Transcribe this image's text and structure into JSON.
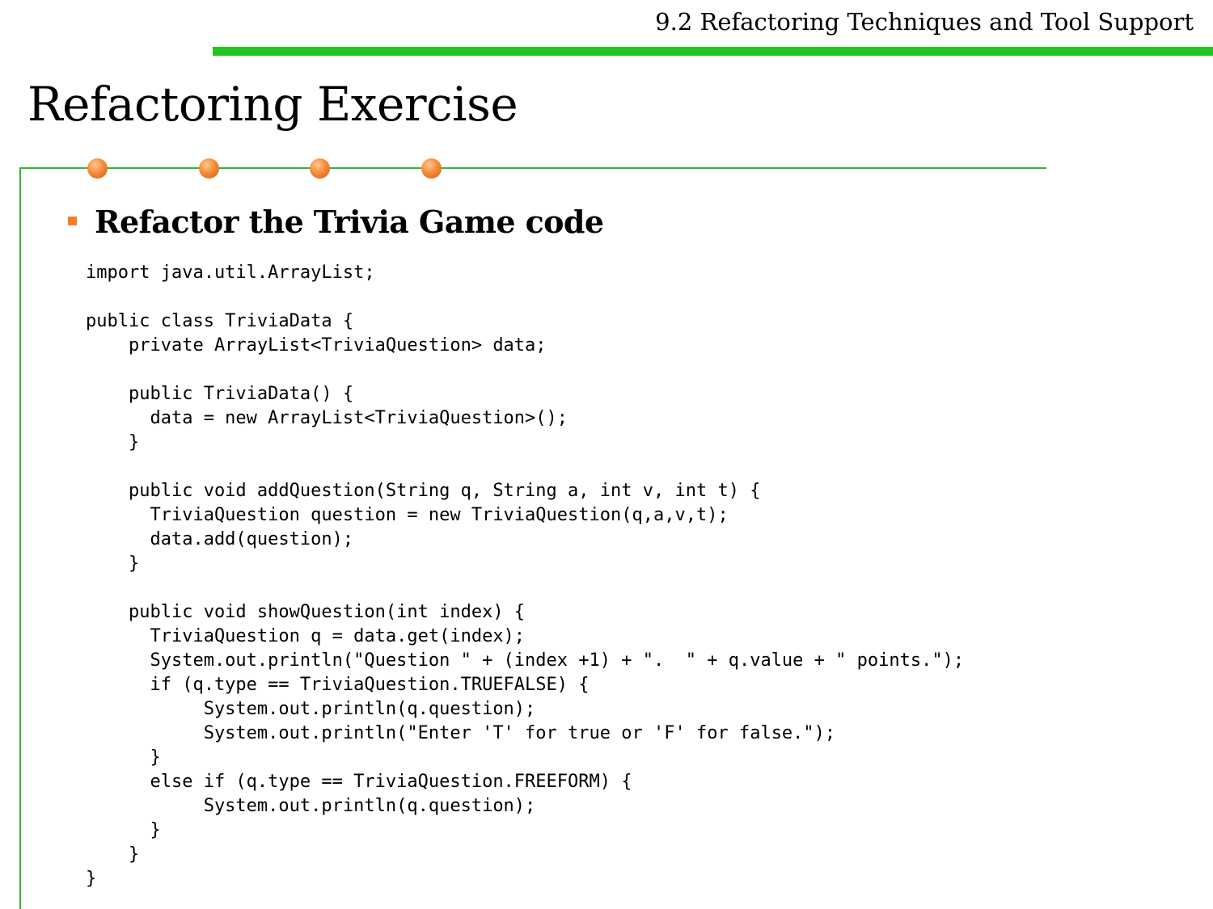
{
  "header": {
    "section_title": "9.2 Refactoring Techniques and Tool Support",
    "accent_color": "#1fc61f"
  },
  "slide": {
    "title": "Refactoring Exercise",
    "bullet": "Refactor the Trivia Game code",
    "bullet_color": "#f77c28",
    "frame_color": "#2fb52f",
    "dot_color": "#f58a3a"
  },
  "code_lines": [
    "import java.util.ArrayList;",
    "",
    "public class TriviaData {",
    "    private ArrayList<TriviaQuestion> data;",
    "",
    "    public TriviaData() {",
    "      data = new ArrayList<TriviaQuestion>();",
    "    }",
    "",
    "    public void addQuestion(String q, String a, int v, int t) {",
    "      TriviaQuestion question = new TriviaQuestion(q,a,v,t);",
    "      data.add(question);",
    "    }",
    "",
    "    public void showQuestion(int index) {",
    "      TriviaQuestion q = data.get(index);",
    "      System.out.println(\"Question \" + (index +1) + \".  \" + q.value + \" points.\");",
    "      if (q.type == TriviaQuestion.TRUEFALSE) {",
    "           System.out.println(q.question);",
    "           System.out.println(\"Enter 'T' for true or 'F' for false.\");",
    "      }",
    "      else if (q.type == TriviaQuestion.FREEFORM) {",
    "           System.out.println(q.question);",
    "      }",
    "    }",
    "}"
  ]
}
